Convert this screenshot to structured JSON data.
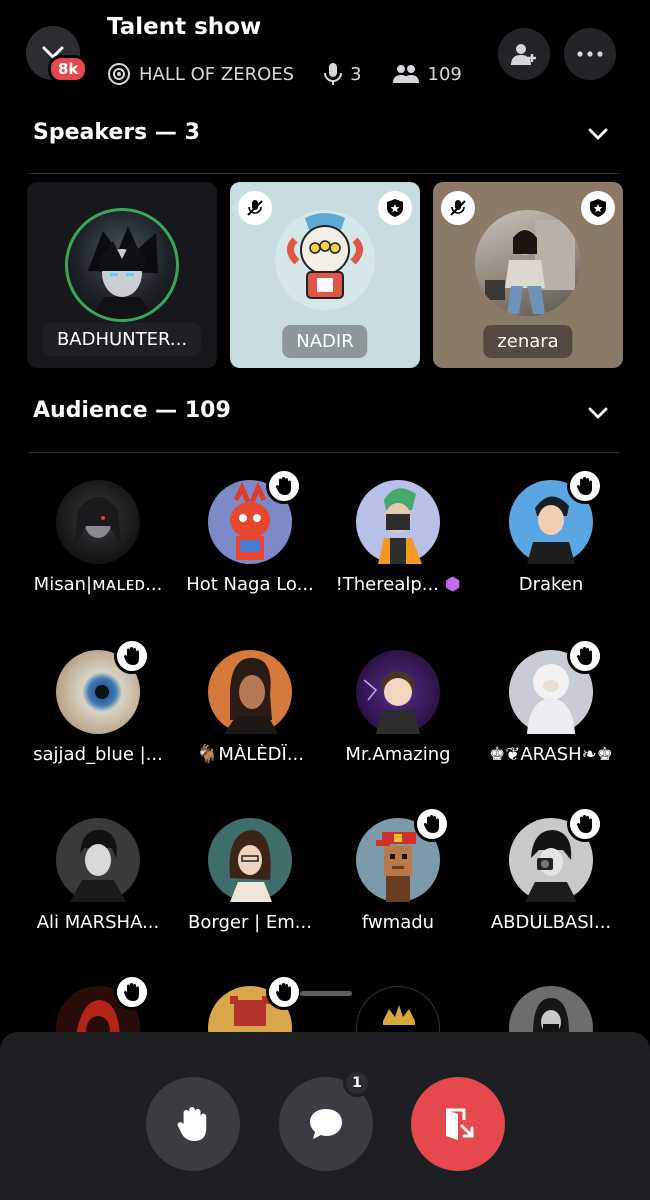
{
  "header": {
    "title": "Talent show",
    "badge": "8k",
    "channel": "HALL OF ZEROES",
    "speaker_count": "3",
    "listener_count": "109"
  },
  "speakers": {
    "heading": "Speakers — 3",
    "cards": [
      {
        "name": "BADHUNTER..."
      },
      {
        "name": "NADIR"
      },
      {
        "name": "zenara"
      }
    ]
  },
  "audience": {
    "heading": "Audience — 109",
    "members": [
      {
        "name": "Misan|ᴍᴀʟᴇᴅ..."
      },
      {
        "name": "Hot Naga Lo..."
      },
      {
        "name": "!Therealp..."
      },
      {
        "name": "Draken"
      },
      {
        "name": "sajjad_blue |..."
      },
      {
        "name": "🐐MÀLÈDÏ..."
      },
      {
        "name": "Mr.Amazing"
      },
      {
        "name": "♚❦ARASH❧♚"
      },
      {
        "name": "Ali MARSHA..."
      },
      {
        "name": "Borger | Em..."
      },
      {
        "name": "fwmadu"
      },
      {
        "name": "ABDULBASI..."
      }
    ]
  },
  "controls": {
    "chat_notifications": "1"
  },
  "colors": {
    "danger": "#e5484d",
    "card_nadir": "#c9dde0",
    "card_zenara": "#8a7b68"
  }
}
